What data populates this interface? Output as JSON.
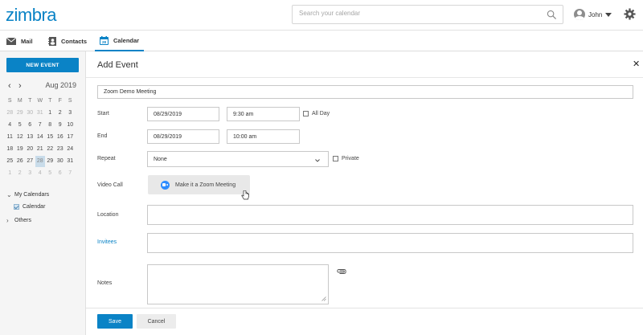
{
  "app": {
    "logo": "zimbra"
  },
  "header": {
    "search_placeholder": "Search your calendar",
    "user_name": "John"
  },
  "nav": {
    "tabs": [
      {
        "label": "Mail",
        "icon": "envelope-icon"
      },
      {
        "label": "Contacts",
        "icon": "address-book-icon"
      },
      {
        "label": "Calendar",
        "icon": "calendar-icon",
        "active": true
      }
    ]
  },
  "sidebar": {
    "new_event_label": "NEW EVENT",
    "mini_calendar": {
      "month_label": "Aug 2019",
      "weekdays": [
        "S",
        "M",
        "T",
        "W",
        "T",
        "F",
        "S"
      ],
      "weeks": [
        [
          {
            "d": "28",
            "m": true
          },
          {
            "d": "29",
            "m": true
          },
          {
            "d": "30",
            "m": true
          },
          {
            "d": "31",
            "m": true
          },
          {
            "d": "1"
          },
          {
            "d": "2"
          },
          {
            "d": "3"
          }
        ],
        [
          {
            "d": "4"
          },
          {
            "d": "5"
          },
          {
            "d": "6"
          },
          {
            "d": "7"
          },
          {
            "d": "8"
          },
          {
            "d": "9"
          },
          {
            "d": "10"
          }
        ],
        [
          {
            "d": "11"
          },
          {
            "d": "12"
          },
          {
            "d": "13"
          },
          {
            "d": "14"
          },
          {
            "d": "15"
          },
          {
            "d": "16"
          },
          {
            "d": "17"
          }
        ],
        [
          {
            "d": "18"
          },
          {
            "d": "19"
          },
          {
            "d": "20"
          },
          {
            "d": "21"
          },
          {
            "d": "22"
          },
          {
            "d": "23"
          },
          {
            "d": "24"
          }
        ],
        [
          {
            "d": "25"
          },
          {
            "d": "26"
          },
          {
            "d": "27"
          },
          {
            "d": "28",
            "sel": true
          },
          {
            "d": "29"
          },
          {
            "d": "30"
          },
          {
            "d": "31"
          }
        ],
        [
          {
            "d": "1",
            "m": true
          },
          {
            "d": "2",
            "m": true
          },
          {
            "d": "3",
            "m": true
          },
          {
            "d": "4",
            "m": true
          },
          {
            "d": "5",
            "m": true
          },
          {
            "d": "6",
            "m": true
          },
          {
            "d": "7",
            "m": true
          }
        ]
      ]
    },
    "my_calendars_label": "My Calendars",
    "calendar_item_label": "Calendar",
    "others_label": "Others"
  },
  "form": {
    "title": "Add Event",
    "event_name": "Zoom Demo Meeting",
    "start_label": "Start",
    "start_date": "08/29/2019",
    "start_time": "9:30 am",
    "all_day_label": "All Day",
    "end_label": "End",
    "end_date": "08/29/2019",
    "end_time": "10:00 am",
    "repeat_label": "Repeat",
    "repeat_value": "None",
    "private_label": "Private",
    "video_call_label": "Video Call",
    "zoom_button_label": "Make it a Zoom Meeting",
    "location_label": "Location",
    "location_value": "",
    "invitees_label": "Invitees",
    "invitees_value": "",
    "notes_label": "Notes",
    "notes_value": "",
    "save_label": "Save",
    "cancel_label": "Cancel"
  },
  "colors": {
    "brand": "#0a83c6",
    "selected_day": "#c9dcea",
    "zoom_blue": "#2d8cff"
  }
}
